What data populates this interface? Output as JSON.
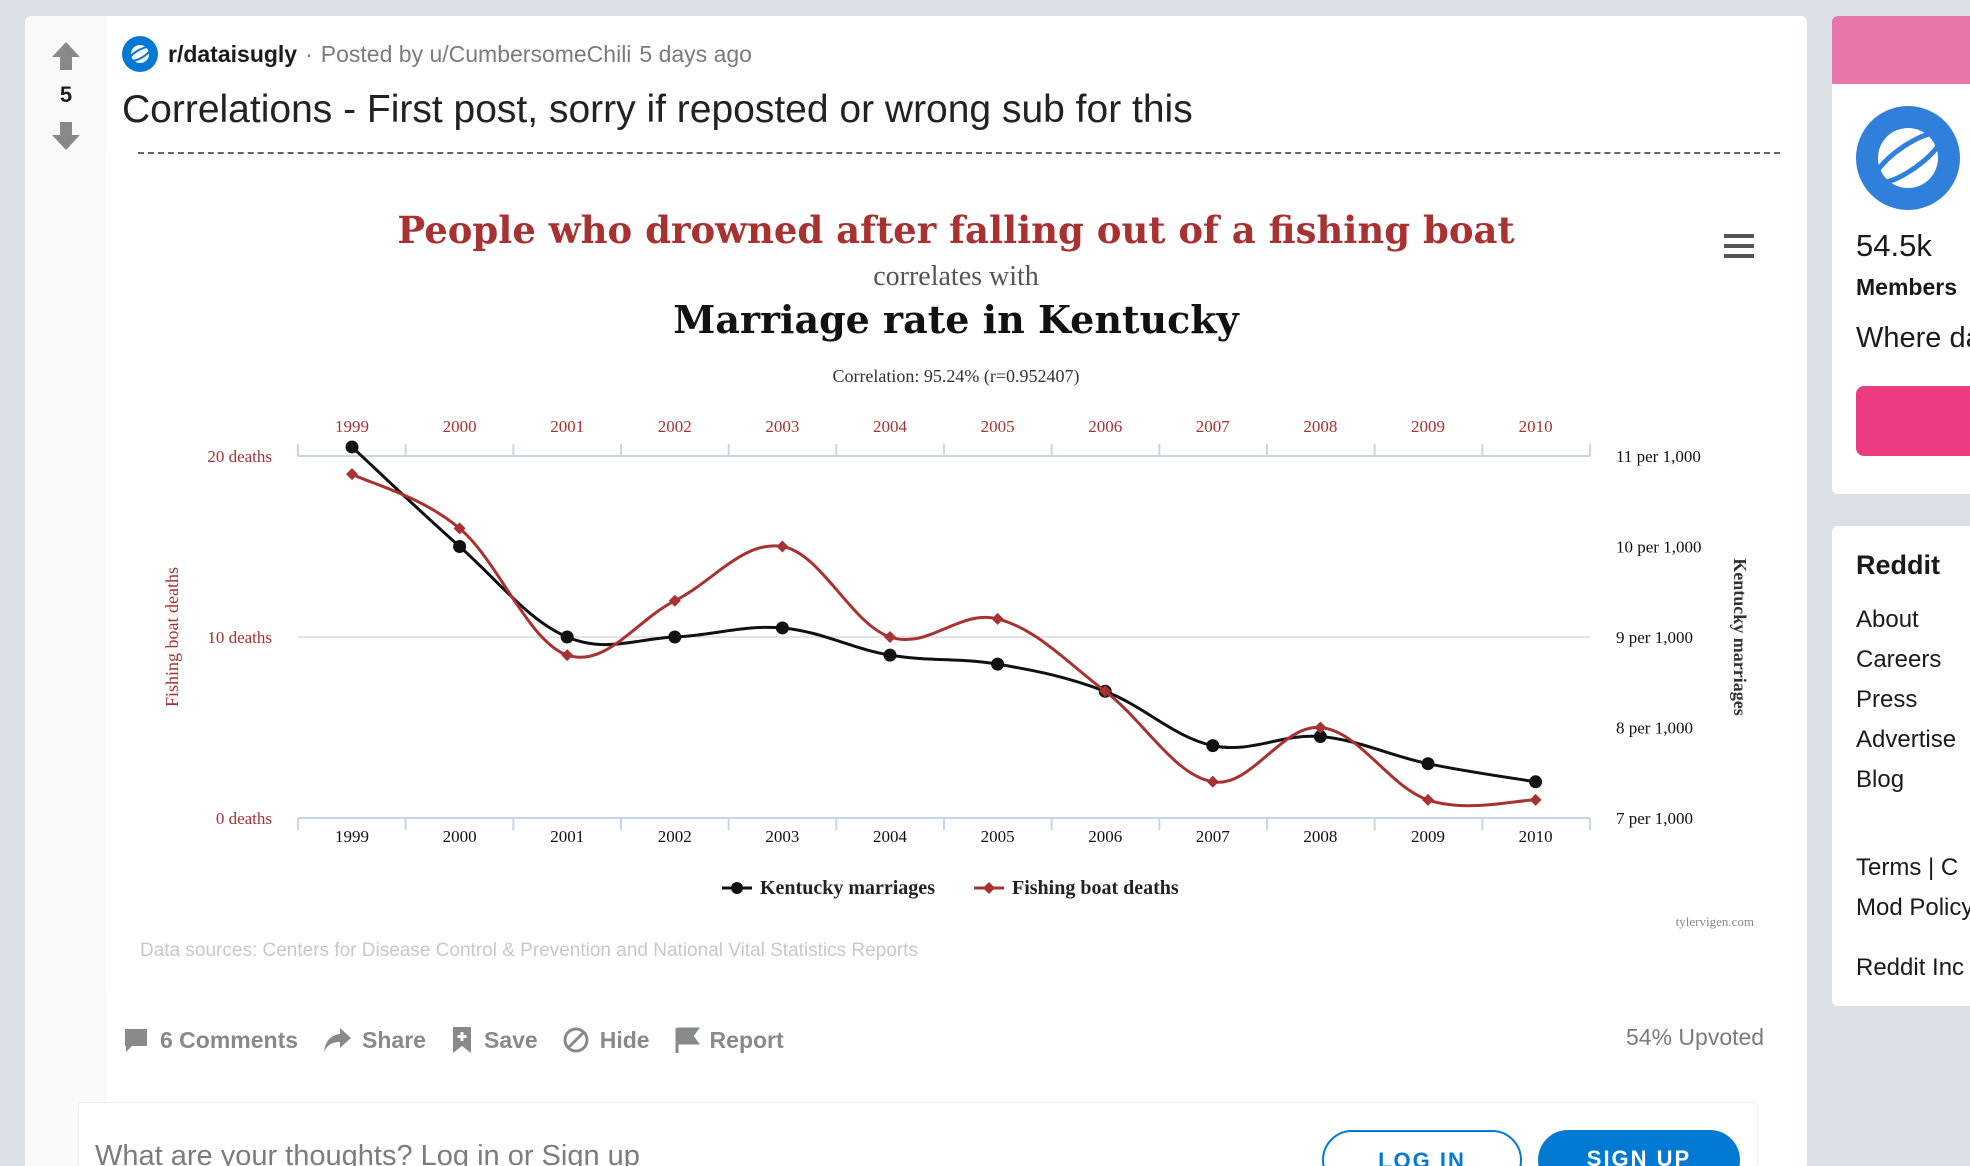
{
  "post": {
    "votes": "5",
    "subreddit": "r/dataisugly",
    "separator": "·",
    "posted_by": "Posted by u/CumbersomeChili",
    "posted_time": "5 days ago",
    "title": "Correlations - First post, sorry if reposted or wrong sub for this"
  },
  "actions": {
    "comments": "6 Comments",
    "share": "Share",
    "save": "Save",
    "hide": "Hide",
    "report": "Report",
    "upvoted": "54% Upvoted"
  },
  "comment": {
    "prompt": "What are your thoughts? Log in or Sign up",
    "login": "LOG IN",
    "signup": "SIGN UP"
  },
  "sidebar": {
    "members_count": "54.5k",
    "members_label": "Members",
    "description": "Where da",
    "reddit_heading": "Reddit",
    "links": [
      "About",
      "Careers",
      "Press",
      "Advertise",
      "Blog"
    ],
    "legal": "Terms  |  C",
    "mod_policy": "Mod Policy",
    "company": "Reddit Inc"
  },
  "colors": {
    "accent_blue": "#0079d3",
    "series_red": "#a83232",
    "series_black": "#111111"
  },
  "chart_data": {
    "type": "line",
    "title": "People who drowned after falling out of a fishing boat",
    "subtitle": "correlates with",
    "title2": "Marriage rate in Kentucky",
    "correlation": "Correlation: 95.24% (r=0.952407)",
    "x": [
      "1999",
      "2000",
      "2001",
      "2002",
      "2003",
      "2004",
      "2005",
      "2006",
      "2007",
      "2008",
      "2009",
      "2010"
    ],
    "ylabel_left": "Fishing boat deaths",
    "ylabel_right": "Kentucky marriages",
    "y_left_ticks": [
      "20 deaths",
      "10 deaths",
      "0 deaths"
    ],
    "y_left_range": [
      0,
      20
    ],
    "y_right_ticks": [
      "11 per 1,000",
      "10 per 1,000",
      "9 per 1,000",
      "8 per 1,000",
      "7 per 1,000"
    ],
    "y_right_range": [
      7,
      11
    ],
    "series": [
      {
        "name": "Kentucky marriages",
        "axis": "right",
        "color": "#111111",
        "values": [
          11.1,
          10.0,
          9.0,
          9.0,
          9.1,
          8.8,
          8.7,
          8.4,
          7.8,
          7.9,
          7.6,
          7.4
        ]
      },
      {
        "name": "Fishing boat deaths",
        "axis": "left",
        "color": "#a83232",
        "values": [
          19,
          16,
          9,
          12,
          15,
          10,
          11,
          7,
          2,
          5,
          1,
          1
        ]
      }
    ],
    "source_note": "Data sources: Centers for Disease Control & Prevention and National Vital Statistics Reports",
    "credit": "tylervigen.com",
    "legend_position": "bottom-center"
  }
}
